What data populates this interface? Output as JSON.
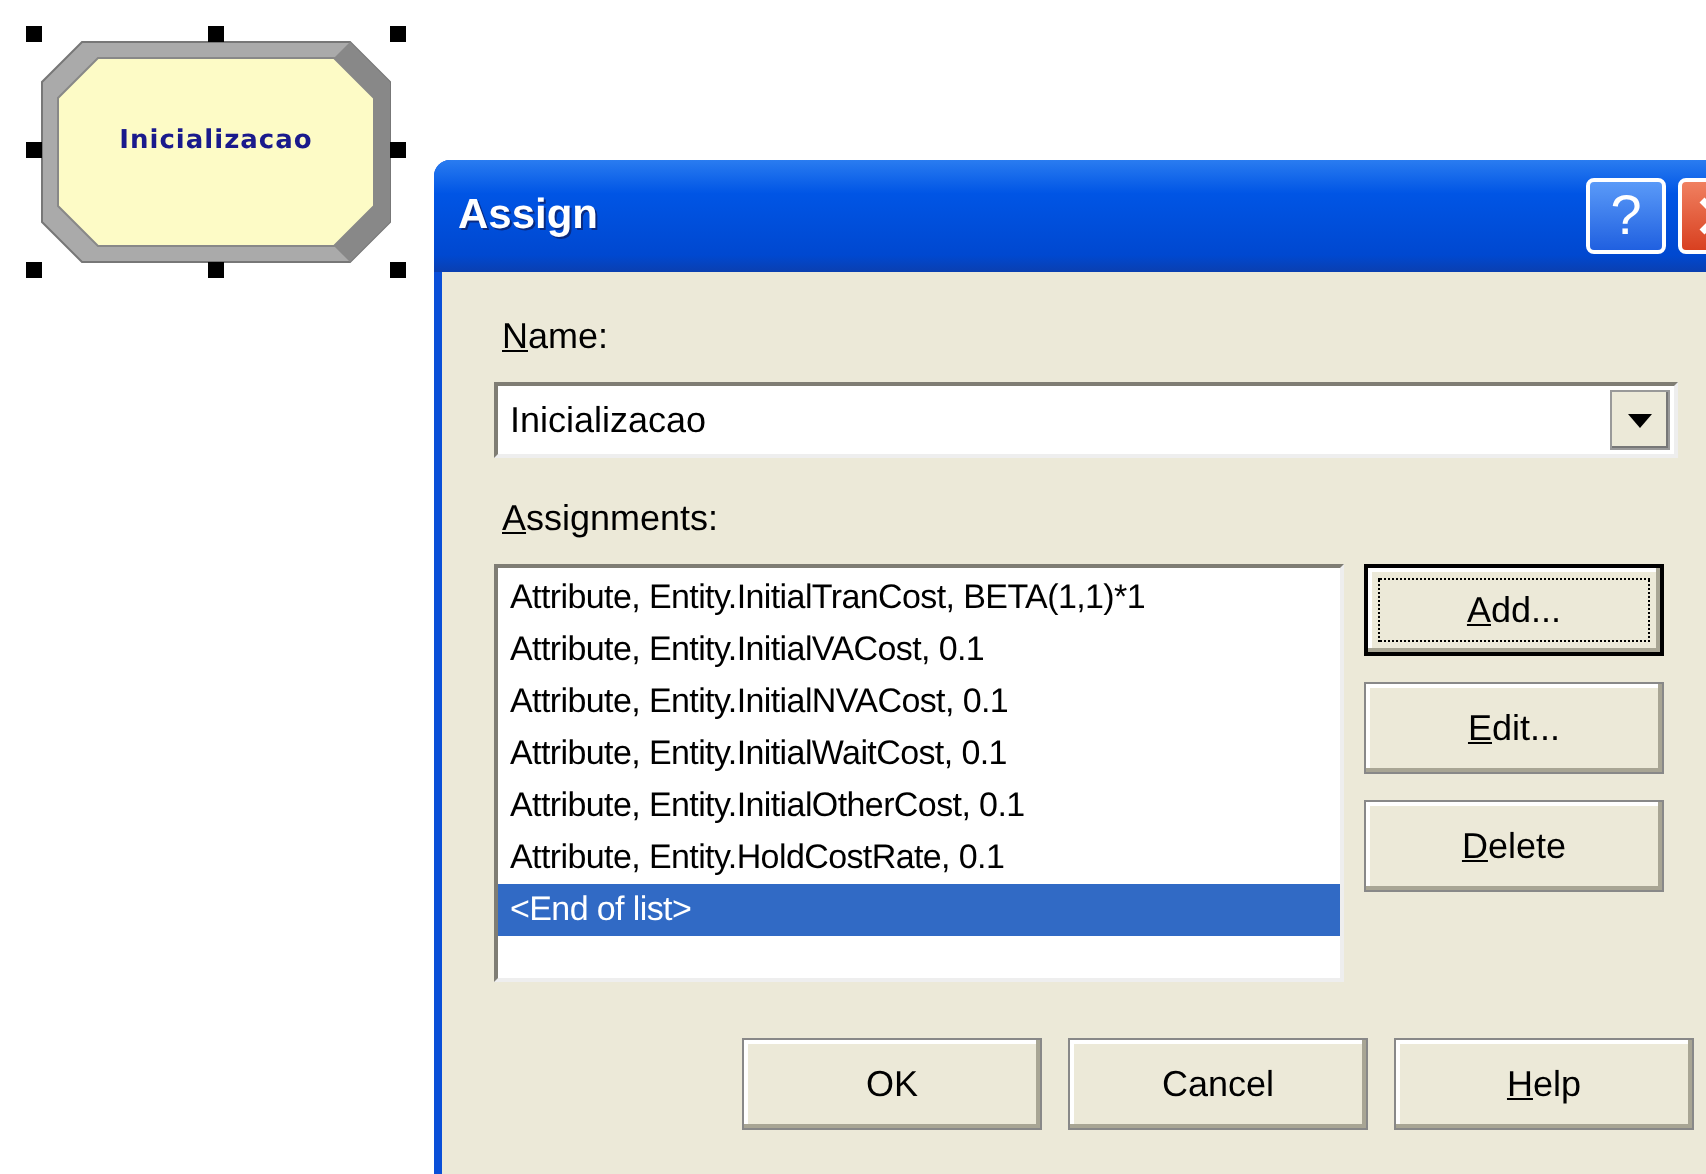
{
  "canvas": {
    "module": {
      "label": "Inicializacao",
      "selected": true
    }
  },
  "dialog": {
    "title": "Assign",
    "title_buttons": [
      {
        "kind": "help",
        "label": "?"
      },
      {
        "kind": "close"
      }
    ],
    "name_label": {
      "text": "Name:",
      "access_key": true
    },
    "name_value": "Inicializacao",
    "assignments_label": {
      "text": "Assignments:",
      "access_key": true
    },
    "assignments": [
      {
        "text": "Attribute, Entity.InitialTranCost, BETA(1,1)*1",
        "selected": false
      },
      {
        "text": "Attribute, Entity.InitialVACost, 0.1",
        "selected": false
      },
      {
        "text": "Attribute, Entity.InitialNVACost, 0.1",
        "selected": false
      },
      {
        "text": "Attribute, Entity.InitialWaitCost, 0.1",
        "selected": false
      },
      {
        "text": "Attribute, Entity.InitialOtherCost, 0.1",
        "selected": false
      },
      {
        "text": "Attribute, Entity.HoldCostRate, 0.1",
        "selected": false
      },
      {
        "text": "<End of list>",
        "selected": true
      }
    ],
    "side_buttons": [
      {
        "label": "Add...",
        "access_key": true,
        "default": true
      },
      {
        "label": "Edit...",
        "access_key": true,
        "default": false
      },
      {
        "label": "Delete",
        "access_key": true,
        "default": false
      }
    ],
    "bottom_buttons": [
      {
        "label": "OK",
        "access_key": false
      },
      {
        "label": "Cancel",
        "access_key": false
      },
      {
        "label": "Help",
        "access_key": true
      }
    ]
  }
}
